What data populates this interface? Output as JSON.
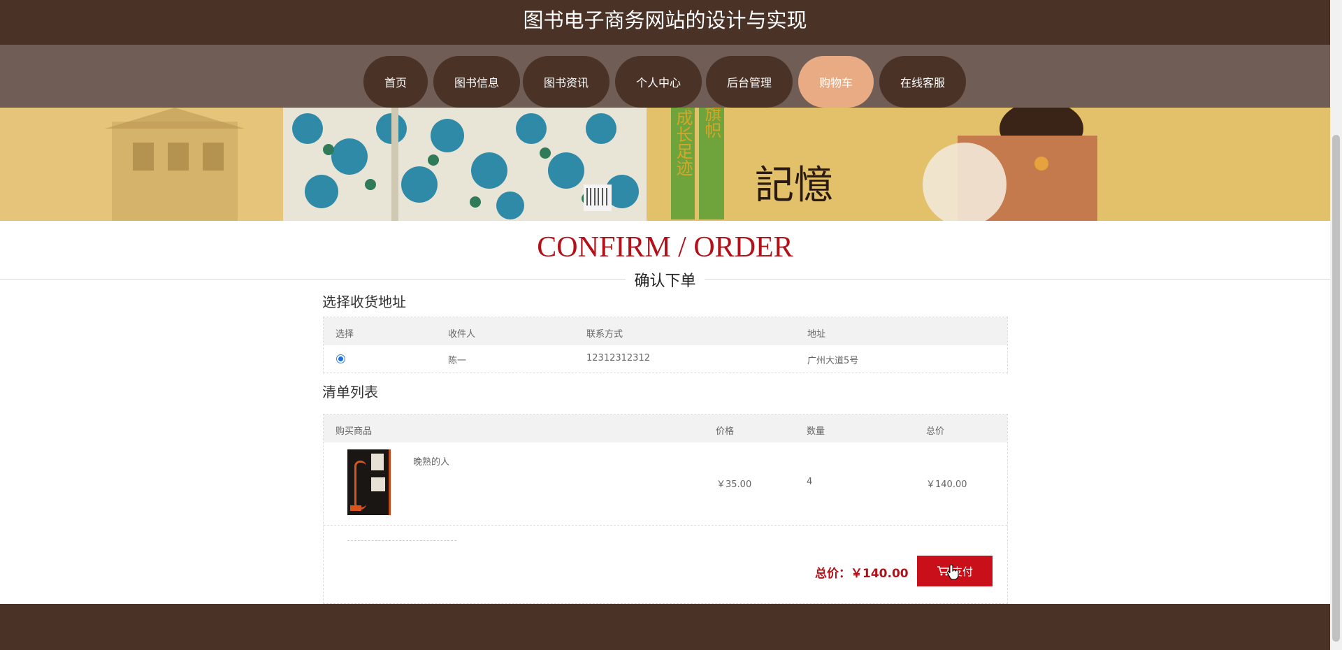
{
  "header": {
    "title": "图书电子商务网站的设计与实现"
  },
  "nav": {
    "items": [
      {
        "label": "首页"
      },
      {
        "label": "图书信息"
      },
      {
        "label": "图书资讯"
      },
      {
        "label": "个人中心"
      },
      {
        "label": "后台管理"
      },
      {
        "label": "购物车",
        "active": true
      },
      {
        "label": "在线客服"
      }
    ]
  },
  "banner": {
    "text_vertical_1": "的成长足迹",
    "text_vertical_2": "旗帜",
    "text_right": "記憶"
  },
  "page": {
    "heading_en": "CONFIRM / ORDER",
    "heading_cn": "确认下单"
  },
  "address": {
    "section_title": "选择收货地址",
    "columns": [
      "选择",
      "收件人",
      "联系方式",
      "地址"
    ],
    "rows": [
      {
        "selected": true,
        "recipient": "陈一",
        "phone": "12312312312",
        "address": "广州大道5号"
      }
    ]
  },
  "cart": {
    "section_title": "清单列表",
    "columns": [
      "购买商品",
      "价格",
      "数量",
      "总价"
    ],
    "items": [
      {
        "name": "晚熟的人",
        "price": "￥35.00",
        "quantity": "4",
        "total": "￥140.00"
      }
    ]
  },
  "summary": {
    "total_label": "总价：",
    "total_value": "￥140.00",
    "pay_label": "支付"
  },
  "colors": {
    "header_bg": "#4a3227",
    "nav_bg": "#705e56",
    "nav_active": "#e8ab83",
    "accent_red": "#c9101a"
  }
}
